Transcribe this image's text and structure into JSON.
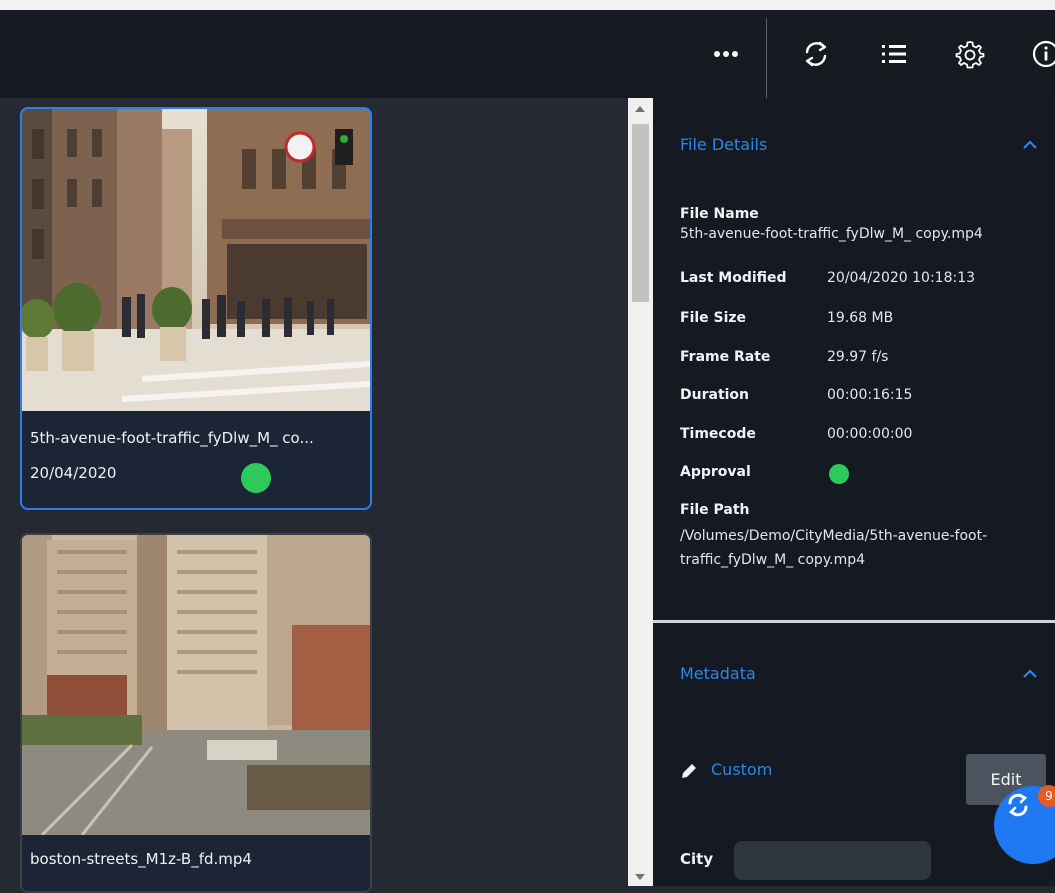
{
  "toolbar": {
    "icons": [
      "more-icon",
      "refresh-icon",
      "list-icon",
      "gear-icon",
      "info-icon"
    ]
  },
  "grid": {
    "cards": [
      {
        "title": "5th-avenue-foot-traffic_fyDlw_M_ co...",
        "date": "20/04/2020",
        "approval_color": "#2dca5b",
        "selected": true
      },
      {
        "title": "boston-streets_M1z-B_fd.mp4",
        "selected": false
      }
    ]
  },
  "panel": {
    "file_details": {
      "title": "File Details",
      "file_name_label": "File Name",
      "file_name_value": "5th-avenue-foot-traffic_fyDlw_M_ copy.mp4",
      "last_modified_label": "Last Modified",
      "last_modified_value": "20/04/2020 10:18:13",
      "file_size_label": "File Size",
      "file_size_value": "19.68 MB",
      "frame_rate_label": "Frame Rate",
      "frame_rate_value": "29.97 f/s",
      "duration_label": "Duration",
      "duration_value": "00:00:16:15",
      "timecode_label": "Timecode",
      "timecode_value": "00:00:00:00",
      "approval_label": "Approval",
      "file_path_label": "File Path",
      "file_path_line1": "/Volumes/Demo/CityMedia/5th-avenue-foot-",
      "file_path_line2": "traffic_fyDlw_M_ copy.mp4"
    },
    "metadata": {
      "title": "Metadata",
      "custom_label": "Custom",
      "edit_label": "Edit",
      "city_label": "City",
      "city_value": ""
    }
  },
  "fab": {
    "badge": "9"
  },
  "colors": {
    "accent": "#2d86e6",
    "approval_green": "#2dca5b",
    "fab_blue": "#1f78f2",
    "badge_orange": "#e85a23"
  }
}
